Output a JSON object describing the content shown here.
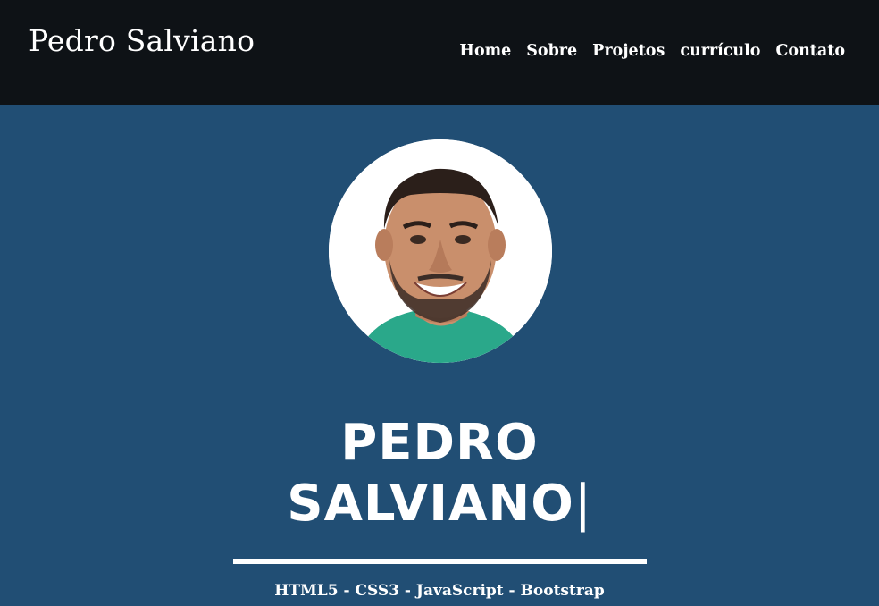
{
  "navbar": {
    "brand": "Pedro Salviano",
    "links": [
      {
        "label": "Home"
      },
      {
        "label": "Sobre"
      },
      {
        "label": "Projetos"
      },
      {
        "label": "currículo"
      },
      {
        "label": "Contato"
      }
    ]
  },
  "hero": {
    "name_line1": "PEDRO",
    "name_line2": "SALVIANO",
    "cursor": "|",
    "skills": "HTML5 - CSS3 - JavaScript - Bootstrap"
  },
  "colors": {
    "navbar_bg": "#0e1216",
    "hero_bg": "#214e74",
    "text": "#ffffff",
    "shirt": "#2aa88a"
  },
  "icons": {
    "avatar": "profile-photo"
  }
}
